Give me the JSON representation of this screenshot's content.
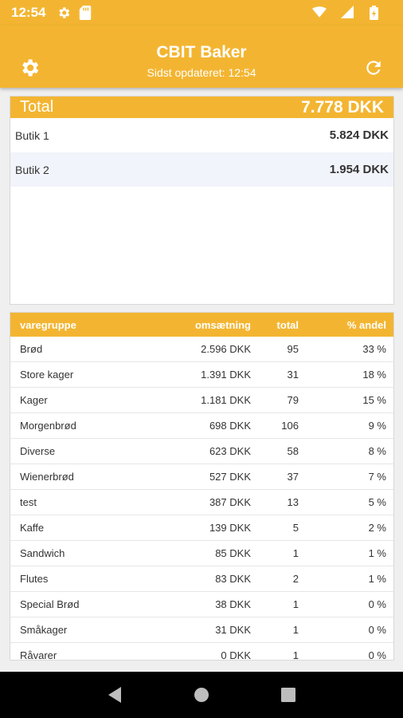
{
  "status_bar": {
    "time": "12:54",
    "icons": [
      "gear-icon",
      "sd-card-icon",
      "wifi-icon",
      "signal-icon",
      "battery-icon"
    ]
  },
  "app_bar": {
    "title": "CBIT Baker",
    "subtitle": "Sidst opdateret: 12:54",
    "left_icon": "settings-gear-icon",
    "right_icon": "refresh-icon",
    "color": "#f3b531"
  },
  "total_card": {
    "label": "Total",
    "value": "7.778 DKK",
    "shops": [
      {
        "name": "Butik 1",
        "amount": "5.824 DKK"
      },
      {
        "name": "Butik 2",
        "amount": "1.954 DKK"
      }
    ]
  },
  "groups_table": {
    "headers": {
      "group": "varegruppe",
      "turnover": "omsætning",
      "total": "total",
      "share": "% andel"
    },
    "rows": [
      {
        "group": "Brød",
        "turnover": "2.596 DKK",
        "total": "95",
        "share": "33 %"
      },
      {
        "group": "Store kager",
        "turnover": "1.391 DKK",
        "total": "31",
        "share": "18 %"
      },
      {
        "group": "Kager",
        "turnover": "1.181 DKK",
        "total": "79",
        "share": "15 %"
      },
      {
        "group": "Morgenbrød",
        "turnover": "698 DKK",
        "total": "106",
        "share": "9 %"
      },
      {
        "group": "Diverse",
        "turnover": "623 DKK",
        "total": "58",
        "share": "8 %"
      },
      {
        "group": "Wienerbrød",
        "turnover": "527 DKK",
        "total": "37",
        "share": "7 %"
      },
      {
        "group": "test",
        "turnover": "387 DKK",
        "total": "13",
        "share": "5 %"
      },
      {
        "group": "Kaffe",
        "turnover": "139 DKK",
        "total": "5",
        "share": "2 %"
      },
      {
        "group": "Sandwich",
        "turnover": "85 DKK",
        "total": "1",
        "share": "1 %"
      },
      {
        "group": "Flutes",
        "turnover": "83 DKK",
        "total": "2",
        "share": "1 %"
      },
      {
        "group": "Special Brød",
        "turnover": "38 DKK",
        "total": "1",
        "share": "0 %"
      },
      {
        "group": "Småkager",
        "turnover": "31 DKK",
        "total": "1",
        "share": "0 %"
      },
      {
        "group": "Råvarer",
        "turnover": "0 DKK",
        "total": "1",
        "share": "0 %"
      }
    ]
  },
  "nav_bar": {
    "icons": [
      "back-icon",
      "home-icon",
      "recents-icon"
    ]
  }
}
